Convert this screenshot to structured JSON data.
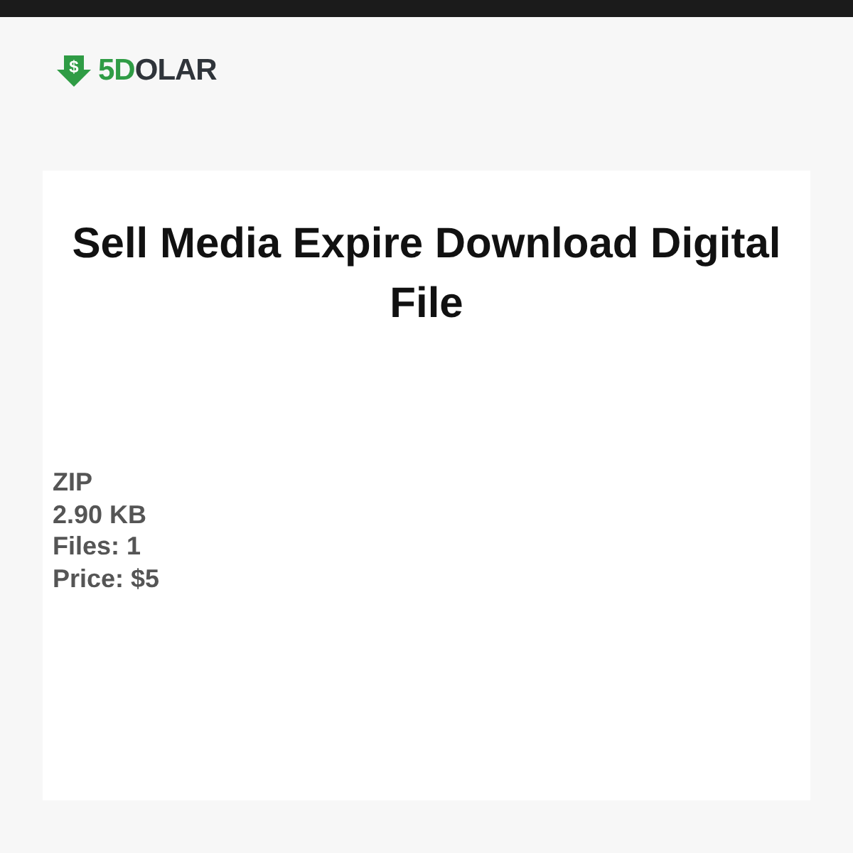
{
  "logo": {
    "badge_symbol": "$",
    "accent": "5D",
    "rest": "OLAR"
  },
  "product": {
    "title": "Sell Media Expire Download Digital File",
    "details": [
      "ZIP",
      "2.90 KB",
      "Files: 1",
      "Price: $5"
    ]
  }
}
